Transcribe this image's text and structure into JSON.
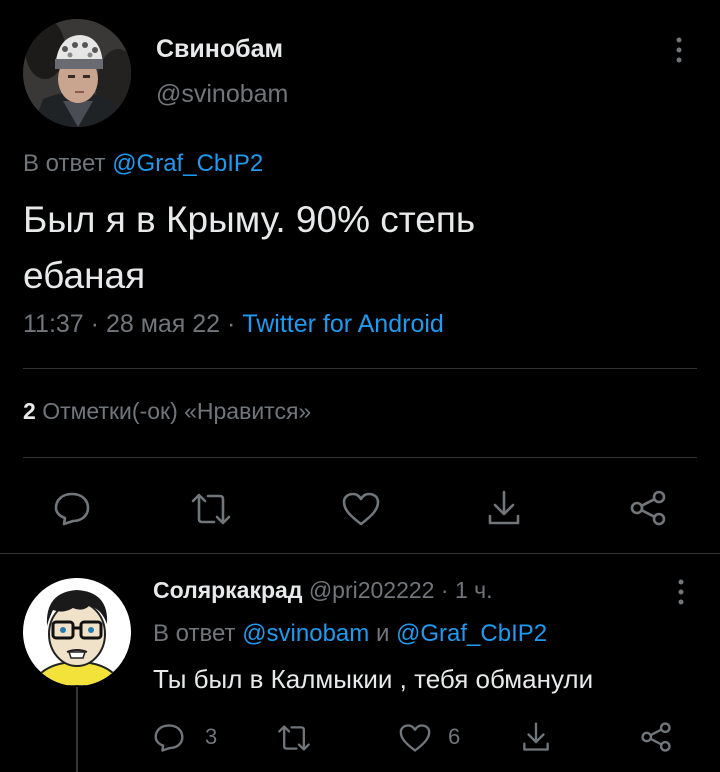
{
  "main_tweet": {
    "author_name": "Свинобам",
    "author_handle": "@svinobam",
    "reply_prefix": "В ответ",
    "reply_to": "@Graf_CbIP2",
    "text_line1": "Был я в Крыму. 90% степь",
    "text_line2": "ебаная",
    "time": "11:37",
    "date": "28 мая 22",
    "sep": "·",
    "client": "Twitter for Android",
    "likes_count": "2",
    "likes_label": "Отметки(-ок) «Нравится»",
    "action_icons": [
      "reply-icon",
      "retweet-icon",
      "like-icon",
      "download-icon",
      "share-icon"
    ],
    "menu_icon": "more-vertical-icon"
  },
  "reply_tweet": {
    "author_name": "Соляркакрад",
    "author_handle": "@pri202222",
    "sep": "·",
    "time_ago": "1 ч.",
    "reply_prefix": "В ответ",
    "reply_to_1": "@svinobam",
    "and_word": "и",
    "reply_to_2": "@Graf_CbIP2",
    "text": "Ты был в Калмыкии , тебя обманули",
    "reply_count": "3",
    "like_count": "6",
    "menu_icon": "more-vertical-icon"
  },
  "colors": {
    "background": "#000000",
    "text": "#e7e9ea",
    "secondary": "#71767b",
    "accent": "#1d9bf0",
    "divider": "#2f3336"
  }
}
